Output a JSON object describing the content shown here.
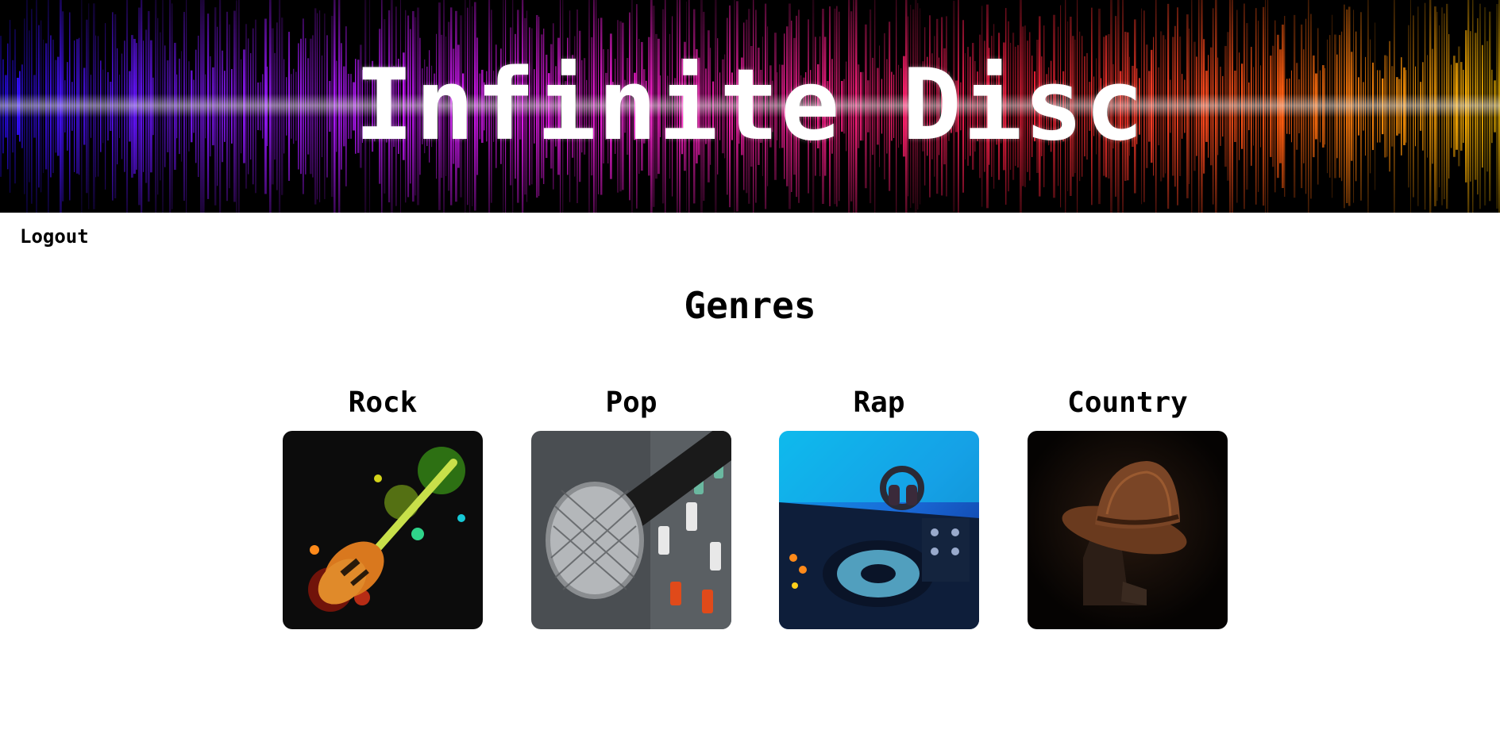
{
  "header": {
    "site_title": "Infinite Disc"
  },
  "nav": {
    "logout_label": "Logout"
  },
  "main": {
    "heading": "Genres",
    "genres": [
      {
        "label": "Rock",
        "image": "electric-guitar-paint-splash"
      },
      {
        "label": "Pop",
        "image": "microphone-on-mixer"
      },
      {
        "label": "Rap",
        "image": "dj-turntable-headphones"
      },
      {
        "label": "Country",
        "image": "cowboy-hat-and-boots"
      }
    ]
  },
  "colors": {
    "background": "#ffffff",
    "text": "#000000",
    "banner_gradient": [
      "#3a10ff",
      "#b21cff",
      "#ff1fb0",
      "#ff2a3a",
      "#ffb400"
    ]
  }
}
